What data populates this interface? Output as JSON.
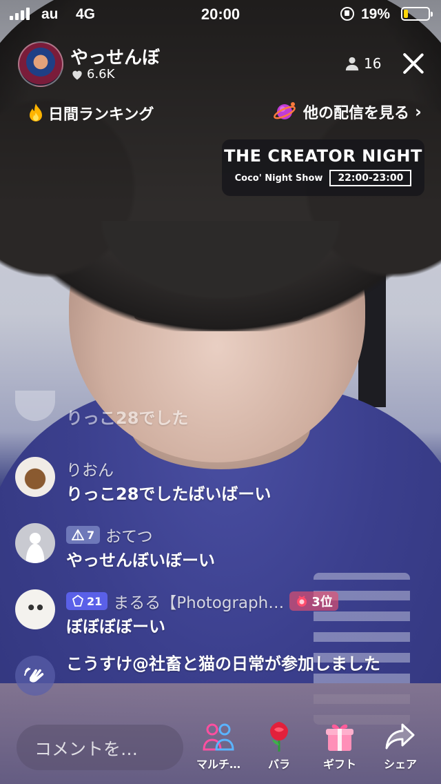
{
  "status_bar": {
    "carrier": "au",
    "network": "4G",
    "time": "20:00",
    "battery_percent": "19%",
    "battery_level": 0.19
  },
  "header": {
    "host_name": "やっせんぼ",
    "likes": "6.6K",
    "viewer_count": "16",
    "daily_ranking": "日間ランキング",
    "other_streams": "他の配信を見る"
  },
  "event_banner": {
    "title": "THE CREATOR NIGHT",
    "show": "Coco' Night Show",
    "time": "22:00-23:00"
  },
  "comments": [
    {
      "user": "",
      "message": "りっこ28でした",
      "faded": true
    },
    {
      "user": "りおん",
      "message": "りっこ28でしたばいばーい"
    },
    {
      "user": "おてつ",
      "level": "7",
      "message": "やっせんぼいぼーい"
    },
    {
      "user": "まるる【Photograph…",
      "level": "21",
      "rank": "3位",
      "message": "ぼぼぼぼーい"
    },
    {
      "user": "",
      "message": "こうすけ@社畜と猫の日常が参加しました",
      "system": true
    }
  ],
  "bottom_bar": {
    "comment_placeholder": "コメントを…",
    "multi_label": "マルチ…",
    "rose_label": "バラ",
    "gift_label": "ギフト",
    "share_label": "シェア"
  },
  "icons": [
    "signal-icon",
    "orientation-lock-icon",
    "battery-icon",
    "heart-icon",
    "person-icon",
    "close-icon",
    "flame-icon",
    "planet-icon",
    "chevron-right-icon",
    "level-badge-icon",
    "rank-badge-icon",
    "wave-hand-icon",
    "multi-guest-icon",
    "rose-icon",
    "gift-icon",
    "share-icon"
  ]
}
